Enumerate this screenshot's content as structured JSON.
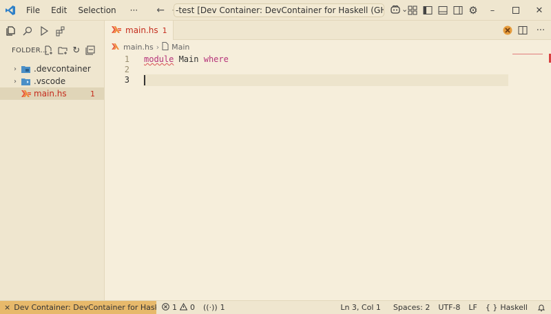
{
  "titlebar": {
    "menu": [
      "File",
      "Edit",
      "Selection",
      "···"
    ],
    "command_center": "-test [Dev Container: DevContainer for Haskell (GHC, Stack, C",
    "copilot_chevron": "⌄"
  },
  "sidebar": {
    "explorer_title": "FOLDER...",
    "tree": [
      {
        "label": ".devcontainer",
        "type": "folder"
      },
      {
        "label": ".vscode",
        "type": "folder"
      },
      {
        "label": "main.hs",
        "type": "file",
        "badge": "1",
        "selected": true
      }
    ]
  },
  "editor": {
    "tab": {
      "name": "main.hs",
      "problems": "1"
    },
    "breadcrumbs": [
      "main.hs",
      "Main"
    ],
    "breadcrumb_sep": "›",
    "lines": [
      {
        "num": "1",
        "tokens": [
          {
            "t": "module",
            "k": "kw-squiggle"
          },
          {
            "t": " Main ",
            "k": "ident"
          },
          {
            "t": "where",
            "k": "kw"
          }
        ]
      },
      {
        "num": "2",
        "tokens": []
      },
      {
        "num": "3",
        "tokens": []
      }
    ]
  },
  "statusbar": {
    "remote": "Dev Container: DevContainer for Haskell ...",
    "errors": "1",
    "warnings": "0",
    "ports": "1",
    "position": "Ln 3, Col 1",
    "spaces": "Spaces: 2",
    "encoding": "UTF-8",
    "eol": "LF",
    "language": "Haskell"
  },
  "colors": {
    "accent_remote": "#e7b96b",
    "error": "#c42b1c",
    "keyword": "#b5337a",
    "haskell_icon": "#e8563a"
  }
}
